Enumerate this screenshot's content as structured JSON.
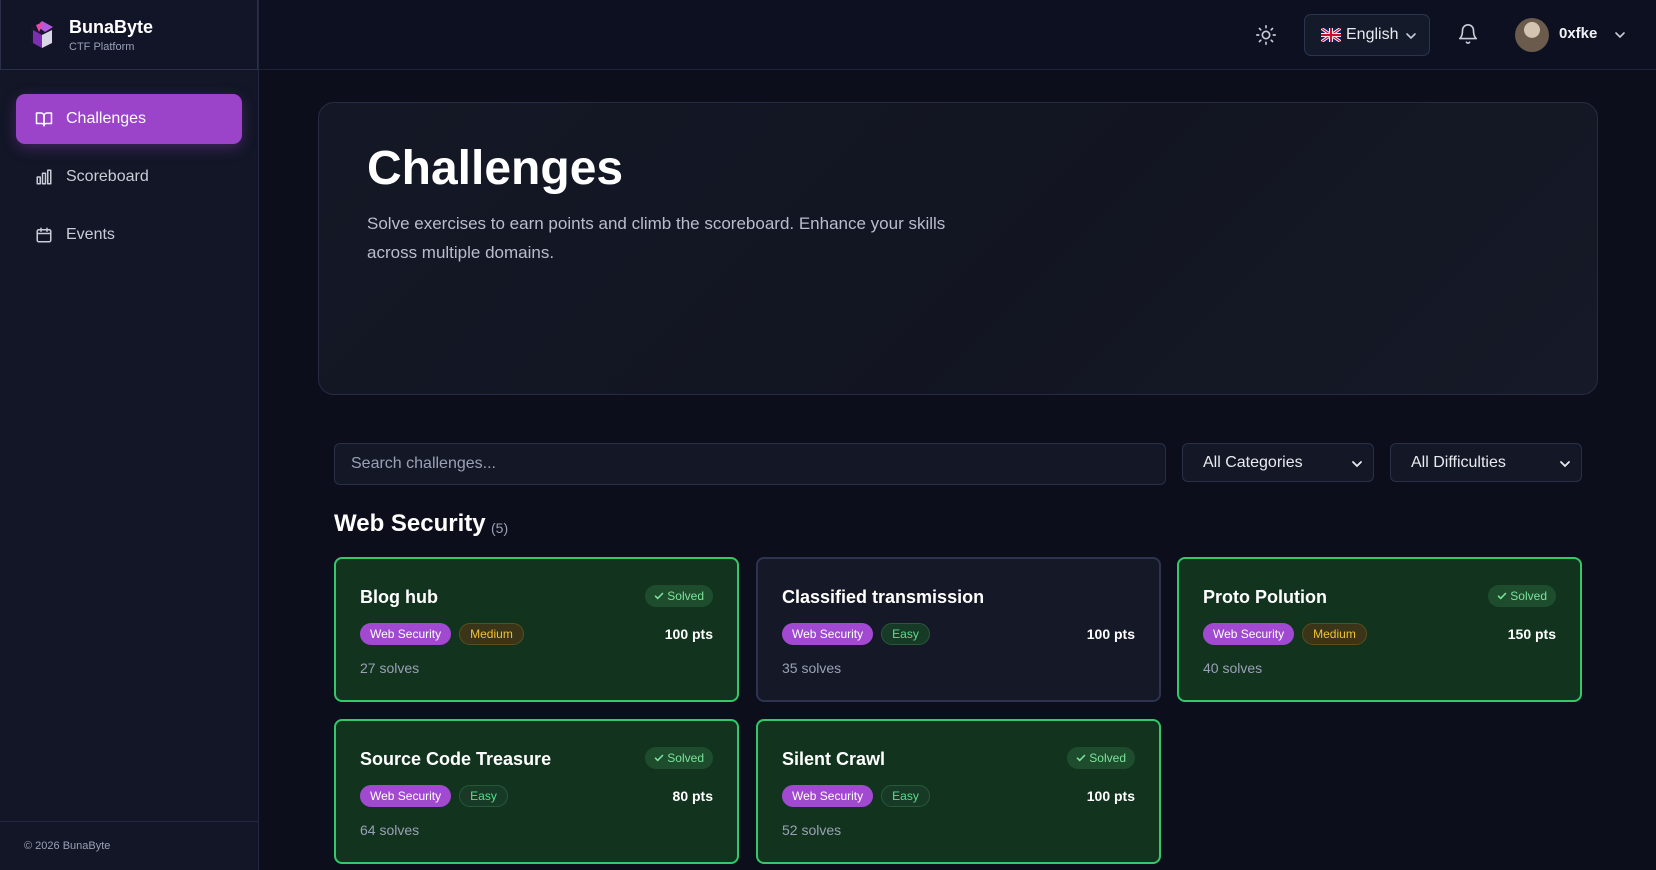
{
  "brand": {
    "name": "BunaByte",
    "subtitle": "CTF Platform"
  },
  "nav": [
    {
      "label": "Challenges",
      "icon": "book-icon",
      "active": true
    },
    {
      "label": "Scoreboard",
      "icon": "bar-chart-icon",
      "active": false
    },
    {
      "label": "Events",
      "icon": "calendar-icon",
      "active": false
    }
  ],
  "footer": {
    "copyright": "© 2026 BunaByte"
  },
  "topbar": {
    "language": "English",
    "username": "0xfke"
  },
  "hero": {
    "title": "Challenges",
    "description": "Solve exercises to earn points and climb the scoreboard. Enhance your skills across multiple domains."
  },
  "filters": {
    "search_placeholder": "Search challenges...",
    "category": "All Categories",
    "difficulty": "All Difficulties"
  },
  "section": {
    "title": "Web Security",
    "count": "(5)"
  },
  "challenges": [
    {
      "title": "Blog hub",
      "category": "Web Security",
      "difficulty": "Medium",
      "points": "100 pts",
      "solves": "27 solves",
      "solved": true,
      "solved_label": "Solved"
    },
    {
      "title": "Classified transmission",
      "category": "Web Security",
      "difficulty": "Easy",
      "points": "100 pts",
      "solves": "35 solves",
      "solved": false,
      "solved_label": ""
    },
    {
      "title": "Proto Polution",
      "category": "Web Security",
      "difficulty": "Medium",
      "points": "150 pts",
      "solves": "40 solves",
      "solved": true,
      "solved_label": "Solved"
    },
    {
      "title": "Source Code Treasure",
      "category": "Web Security",
      "difficulty": "Easy",
      "points": "80 pts",
      "solves": "64 solves",
      "solved": true,
      "solved_label": "Solved"
    },
    {
      "title": "Silent Crawl",
      "category": "Web Security",
      "difficulty": "Easy",
      "points": "100 pts",
      "solves": "52 solves",
      "solved": true,
      "solved_label": "Solved"
    }
  ],
  "colors": {
    "accent": "#9b43c9",
    "solved_border": "#33c86a",
    "medium": "#f0c23a",
    "easy": "#5fdc8b"
  }
}
